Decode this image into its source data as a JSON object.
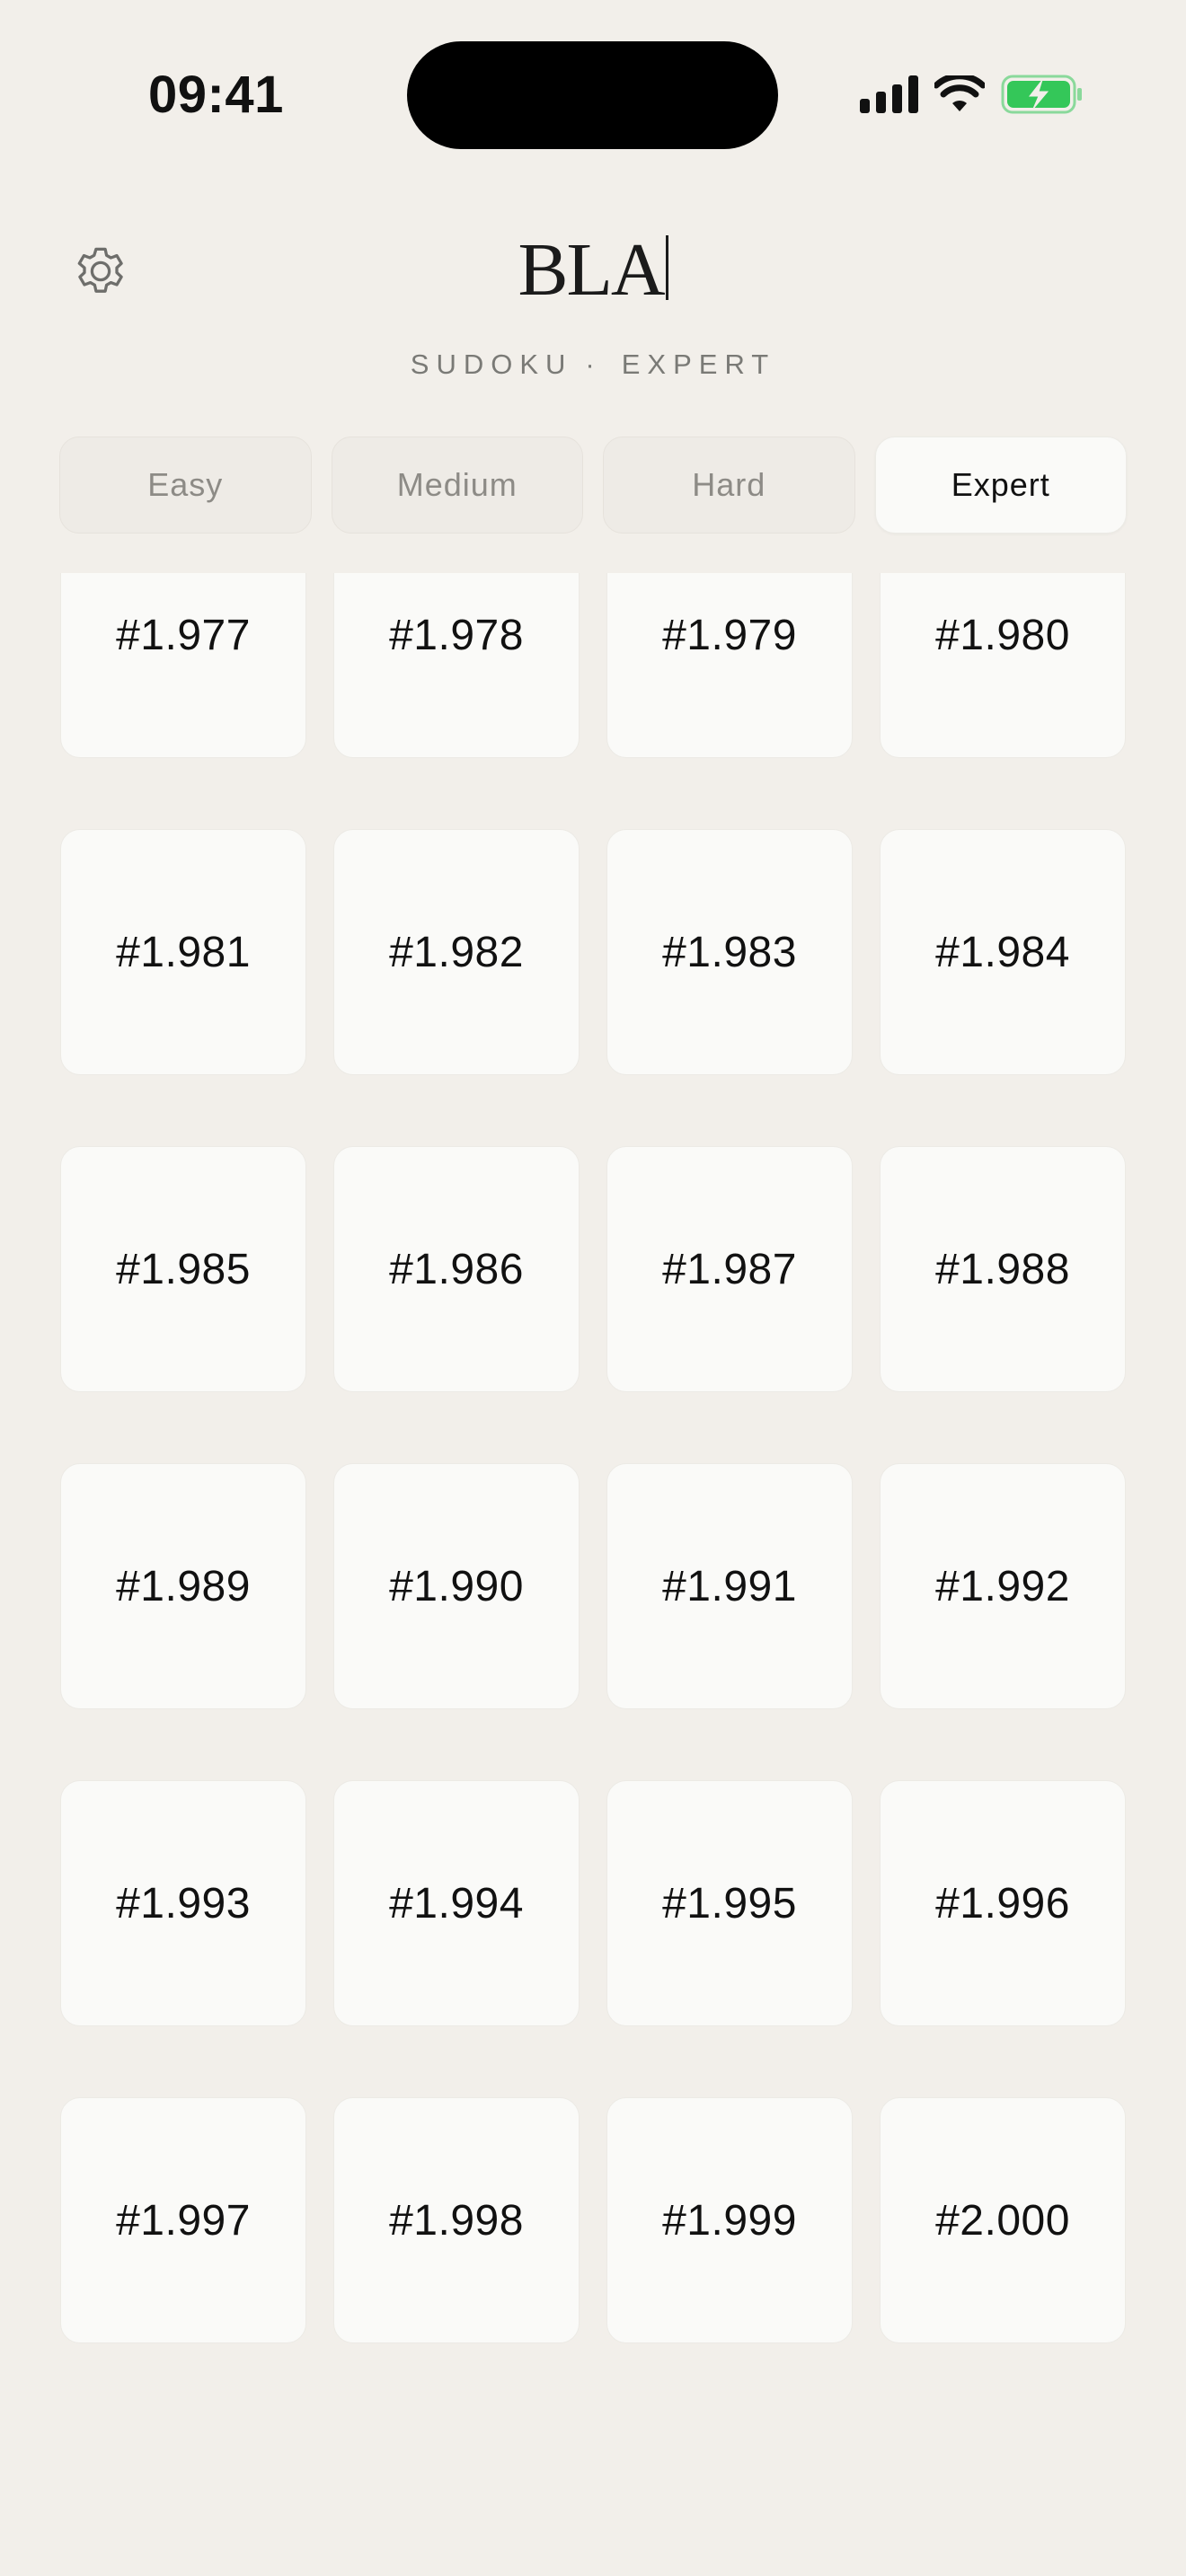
{
  "status_bar": {
    "time": "09:41"
  },
  "header": {
    "logo": "BLA",
    "subtitle_game": "SUDOKU",
    "subtitle_separator": "·",
    "subtitle_level": "EXPERT"
  },
  "tabs": [
    {
      "label": "Easy",
      "active": false
    },
    {
      "label": "Medium",
      "active": false
    },
    {
      "label": "Hard",
      "active": false
    },
    {
      "label": "Expert",
      "active": true
    }
  ],
  "puzzles": [
    "#1.977",
    "#1.978",
    "#1.979",
    "#1.980",
    "#1.981",
    "#1.982",
    "#1.983",
    "#1.984",
    "#1.985",
    "#1.986",
    "#1.987",
    "#1.988",
    "#1.989",
    "#1.990",
    "#1.991",
    "#1.992",
    "#1.993",
    "#1.994",
    "#1.995",
    "#1.996",
    "#1.997",
    "#1.998",
    "#1.999",
    "#2.000"
  ],
  "colors": {
    "background": "#f2efea",
    "tile": "#fafaf8",
    "battery_fill": "#34c759"
  },
  "icons": {
    "settings": "gear-icon",
    "signal": "cellular-signal-icon",
    "wifi": "wifi-icon",
    "battery": "battery-charging-icon"
  }
}
